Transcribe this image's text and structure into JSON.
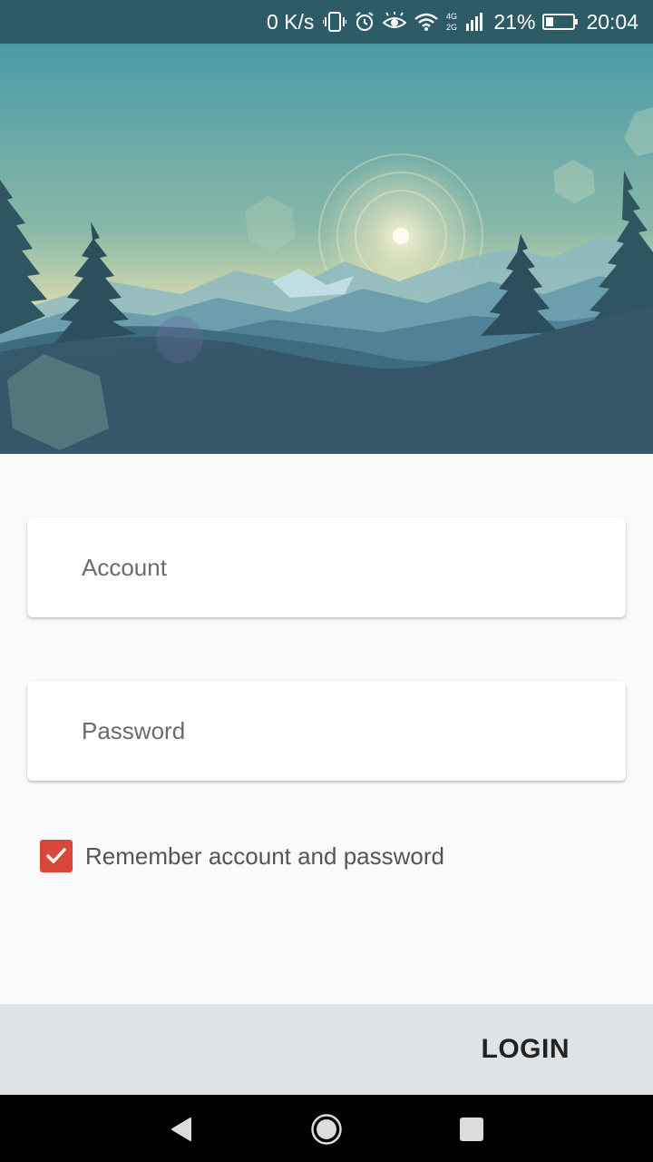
{
  "status_bar": {
    "net_speed": "0 K/s",
    "battery_percent": "21%",
    "time": "20:04",
    "icons": [
      "vibrate-icon",
      "alarm-icon",
      "eye-comfort-icon",
      "wifi-icon",
      "signal-4g-icon",
      "battery-icon"
    ]
  },
  "hero": {
    "description_icon": "mountain-landscape-illustration"
  },
  "form": {
    "account_placeholder": "Account",
    "account_value": "",
    "password_placeholder": "Password",
    "password_value": "",
    "remember_label": "Remember account and password",
    "remember_checked": true
  },
  "actions": {
    "login_label": "LOGIN"
  },
  "nav": {
    "icons": [
      "back-icon",
      "home-icon",
      "recents-icon"
    ]
  },
  "colors": {
    "status_bar": "#2e5c66",
    "checkbox": "#d9473b",
    "action_bar": "#e0e3e6",
    "background": "#fafafa"
  }
}
